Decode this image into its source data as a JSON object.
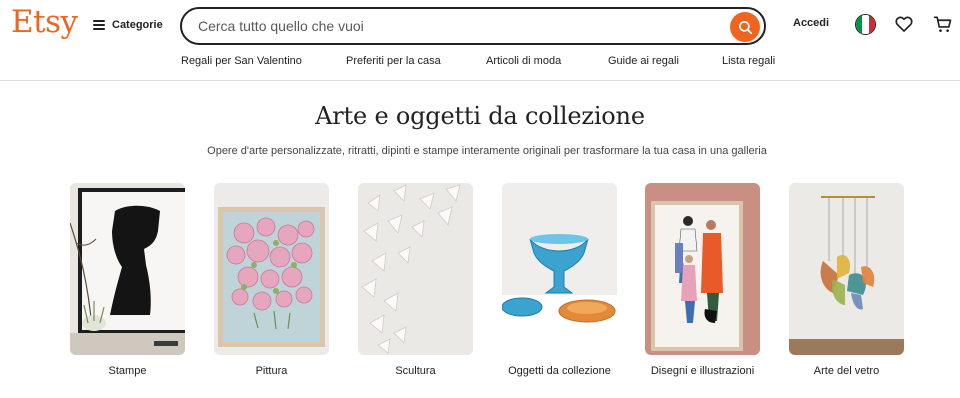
{
  "header": {
    "logo": "Etsy",
    "categories_label": "Categorie",
    "search_placeholder": "Cerca tutto quello che vuoi",
    "signin_label": "Accedi",
    "flag_colors": [
      "#009246",
      "#ffffff",
      "#ce2b37"
    ],
    "icons": {
      "menu": "hamburger-icon",
      "search": "search-icon",
      "favorites": "heart-icon",
      "cart": "cart-icon"
    }
  },
  "subnav": [
    "Regali per San Valentino",
    "Preferiti per la casa",
    "Articoli di moda",
    "Guide ai regali",
    "Lista regali"
  ],
  "main": {
    "title": "Arte e oggetti da collezione",
    "subtitle": "Opere d'arte personalizzate, ritratti, dipinti e stampe interamente originali per trasformare la tua casa in una galleria",
    "categories": [
      {
        "label": "Stampe"
      },
      {
        "label": "Pittura"
      },
      {
        "label": "Scultura"
      },
      {
        "label": "Oggetti da collezione"
      },
      {
        "label": "Disegni e illustrazioni"
      },
      {
        "label": "Arte del vetro"
      }
    ]
  },
  "colors": {
    "brand": "#f1641e",
    "text": "#222222"
  }
}
